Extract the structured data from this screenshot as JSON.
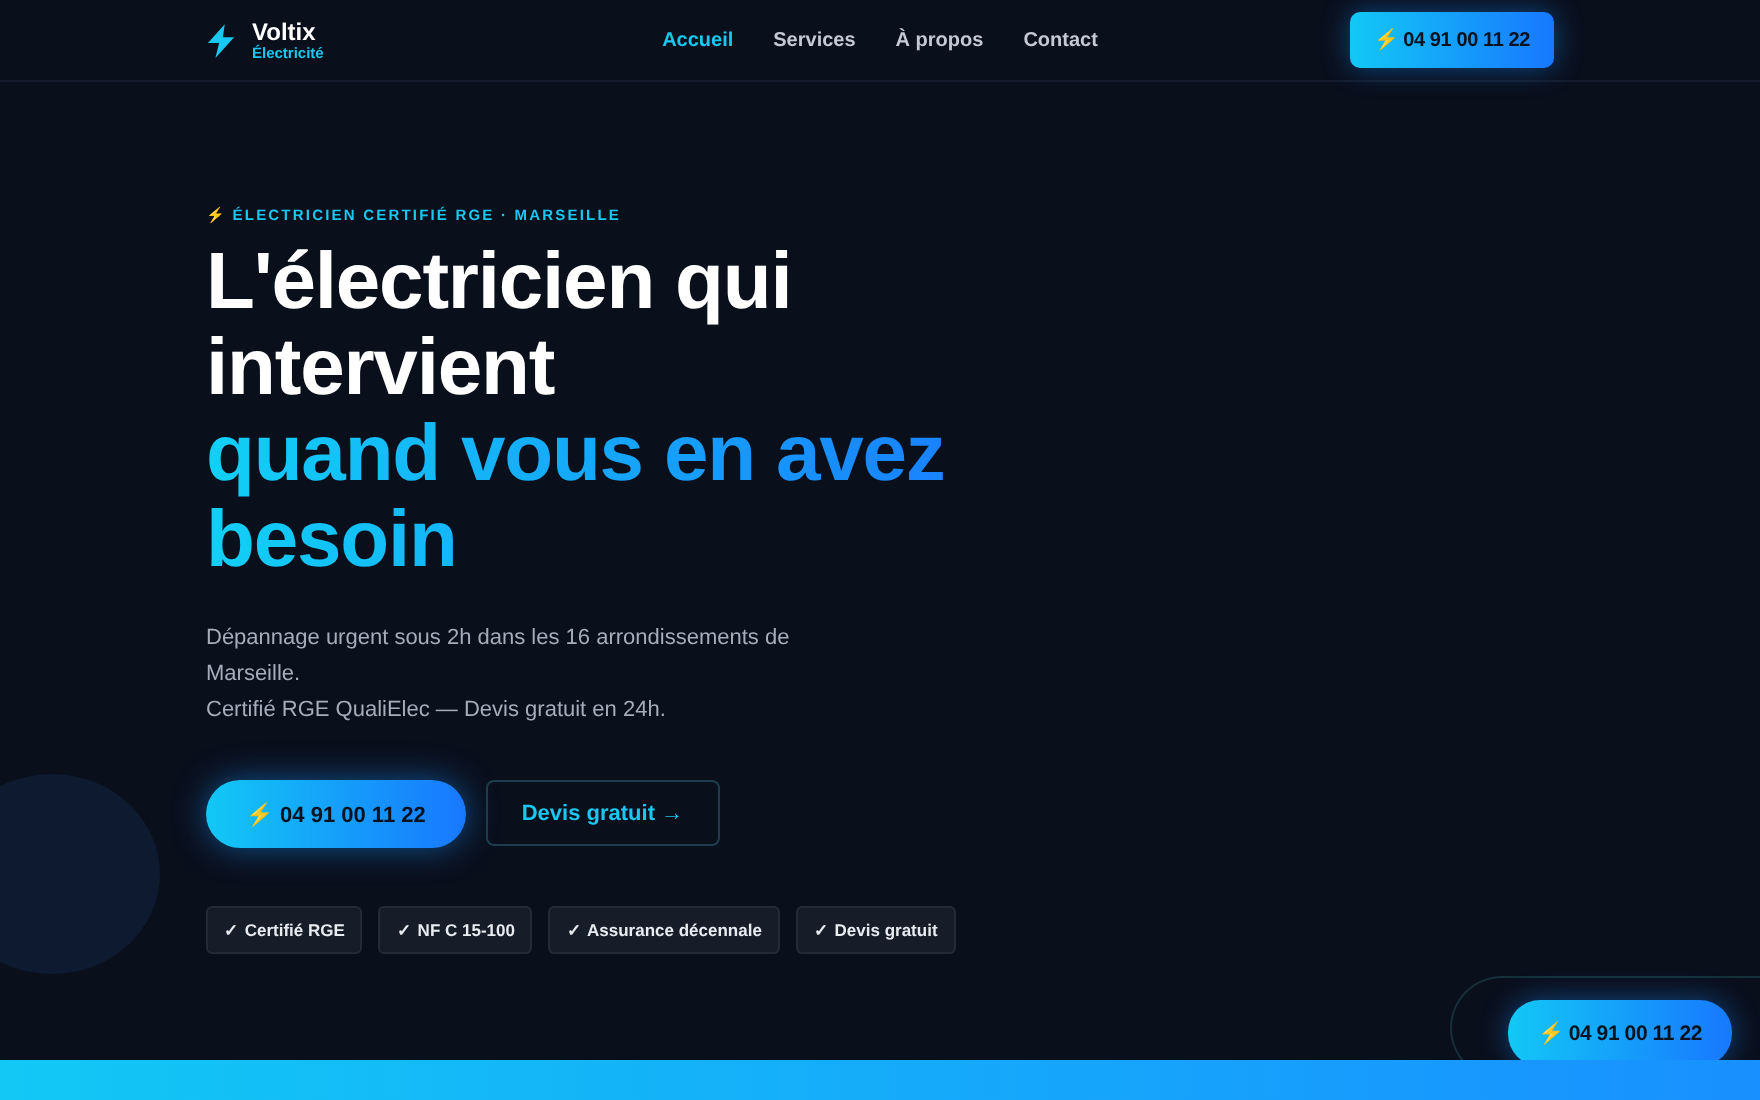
{
  "header": {
    "brand": {
      "name": "Voltix",
      "tagline": "Électricité"
    },
    "nav": [
      {
        "label": "Accueil",
        "selected": true
      },
      {
        "label": "Services",
        "selected": false
      },
      {
        "label": "À propos",
        "selected": false
      },
      {
        "label": "Contact",
        "selected": false
      }
    ],
    "call_button": "⚡ 04 91 00 11 22"
  },
  "hero": {
    "eyebrow": "⚡ ÉLECTRICIEN CERTIFIÉ RGE · MARSEILLE",
    "title": [
      {
        "text": "L'électricien qui intervient",
        "kind": "plain"
      },
      {
        "text": "quand vous en avez besoin",
        "kind": "accent"
      }
    ],
    "description": [
      "Dépannage urgent sous 2h dans les 16 arrondissements de Marseille.",
      "Certifié RGE QualiElec — Devis gratuit en 24h."
    ],
    "buttons": [
      {
        "label": "⚡ 04 91 00 11 22",
        "kind": "primary"
      },
      {
        "label": "Devis gratuit →",
        "kind": "outline"
      }
    ],
    "badges": [
      "✓ Certifié RGE",
      "✓ NF C 15-100",
      "✓ Assurance décennale",
      "✓ Devis gratuit"
    ]
  },
  "floating_call_button": "⚡ 04 91 00 11 22"
}
